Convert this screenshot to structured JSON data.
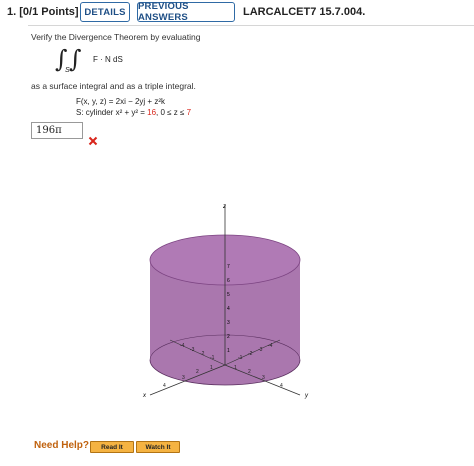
{
  "header": {
    "question_number": "1.",
    "points": "[0/1 Points]",
    "details_label": "DETAILS",
    "previous_answers_label": "PREVIOUS ANSWERS",
    "code": "LARCALCET7 15.7.004."
  },
  "problem": {
    "intro": "Verify the Divergence Theorem by evaluating",
    "integral_sub": "S",
    "integral_expr": "F · N dS",
    "as_line": "as a surface integral and as a triple integral.",
    "field_lhs": "F(x, y, z) = ",
    "field_rhs": "2xi − 2yj + z²k",
    "surface_prefix": "S: cylinder x² + y² = ",
    "surface_r2": "16",
    "surface_mid": ",  0 ≤ z ≤ ",
    "surface_zmax": "7"
  },
  "answer": {
    "value": "196π",
    "status_icon": "x-icon"
  },
  "graph": {
    "axis_x_label": "x",
    "axis_y_label": "y",
    "axis_z_label": "z",
    "z_ticks": [
      "1",
      "2",
      "3",
      "4",
      "5",
      "6",
      "7"
    ],
    "colors": {
      "cylinder": "#9b5fa0",
      "axis": "#333333"
    }
  },
  "help": {
    "label": "Need Help?",
    "read_it": "Read It",
    "watch_it": "Watch It"
  }
}
